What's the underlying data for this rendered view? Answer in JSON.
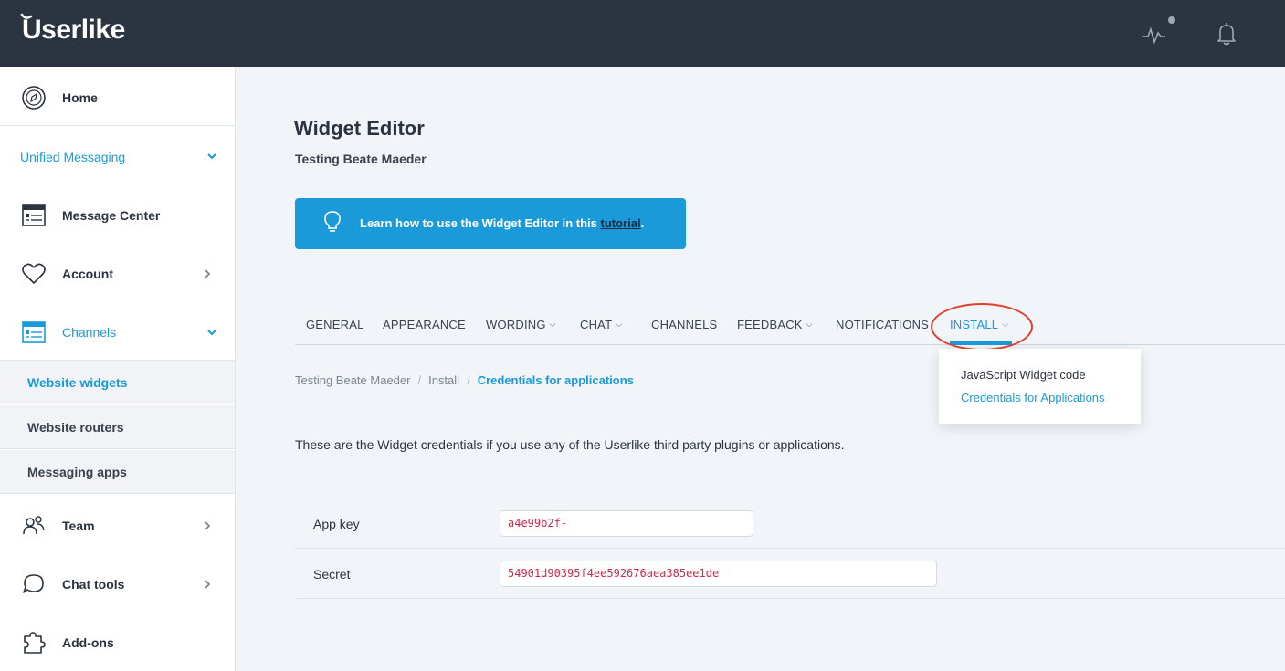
{
  "app": {
    "logo_text": "Userlike",
    "brand_color": "#2c3441",
    "accent_color": "#1a9ad9"
  },
  "topbar": {
    "icons": [
      "activity-icon",
      "notification-bell-icon"
    ]
  },
  "sidebar": {
    "home": "Home",
    "section_title": "Unified Messaging",
    "message_center": "Message Center",
    "account": "Account",
    "channels": "Channels",
    "sub_items": [
      "Website widgets",
      "Website routers",
      "Messaging apps"
    ],
    "team": "Team",
    "chat_tools": "Chat tools",
    "addons": "Add-ons"
  },
  "main": {
    "title": "Widget Editor",
    "subtitle": "Testing Beate Maeder",
    "tip": {
      "text": "Learn how to use the Widget Editor in this ",
      "link": "tutorial",
      "suffix": "."
    },
    "tabs": [
      {
        "label": "GENERAL"
      },
      {
        "label": "APPEARANCE"
      },
      {
        "label": "WORDING"
      },
      {
        "label": "CHAT"
      },
      {
        "label": "CHANNELS"
      },
      {
        "label": "FEEDBACK"
      },
      {
        "label": "NOTIFICATIONS"
      },
      {
        "label": "INSTALL"
      }
    ],
    "dropdown": {
      "options": [
        "JavaScript Widget code",
        "Credentials for Applications"
      ]
    },
    "breadcrumb": [
      "Testing Beate Maeder",
      "Install",
      "Credentials for applications"
    ],
    "description": "These are the Widget credentials if you use any of the Userlike third party plugins or applications.",
    "credentials": [
      {
        "key": "App key",
        "value": "a4e99b2f-"
      },
      {
        "key": "Secret",
        "value": "54901d90395f4ee592676aea385ee1de"
      }
    ]
  }
}
